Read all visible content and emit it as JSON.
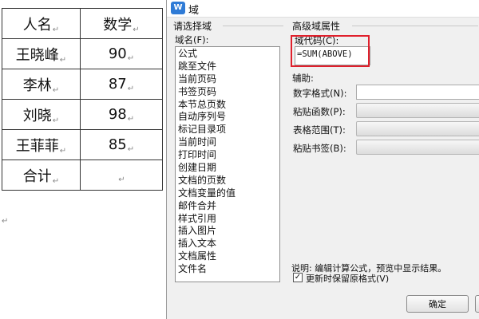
{
  "table": {
    "header": [
      "人名",
      "数学"
    ],
    "rows": [
      [
        "王晓峰",
        "90"
      ],
      [
        "李林",
        "87"
      ],
      [
        "刘晓",
        "98"
      ],
      [
        "王菲菲",
        "85"
      ],
      [
        "合计",
        ""
      ]
    ],
    "cell_mark": "↵"
  },
  "dialog": {
    "icon": "W",
    "title": "域",
    "select_group": "请选择域",
    "field_name_label": "域名(F):",
    "fields": [
      "公式",
      "跳至文件",
      "当前页码",
      "书签页码",
      "本节总页数",
      "自动序列号",
      "标记目录项",
      "当前时间",
      "打印时间",
      "创建日期",
      "文档的页数",
      "文档变量的值",
      "邮件合并",
      "样式引用",
      "插入图片",
      "插入文本",
      "文档属性",
      "文件名"
    ],
    "advanced_group": "高级域属性",
    "field_code_label": "域代码(C):",
    "field_code_value": "=SUM(ABOVE)",
    "aux_label": "辅助:",
    "number_format_label": "数字格式(N):",
    "paste_function_label": "粘贴函数(P):",
    "table_range_label": "表格范围(T):",
    "paste_bookmark_label": "粘贴书签(B):",
    "description": "说明: 编辑计算公式，预览中显示结果。",
    "preserve_format_label": "更新时保留原格式(V)",
    "preserve_format_checked": "✓",
    "ok_label": "确定"
  },
  "colors": {
    "highlight": "#e0202c",
    "icon": "#2f7bd6"
  }
}
